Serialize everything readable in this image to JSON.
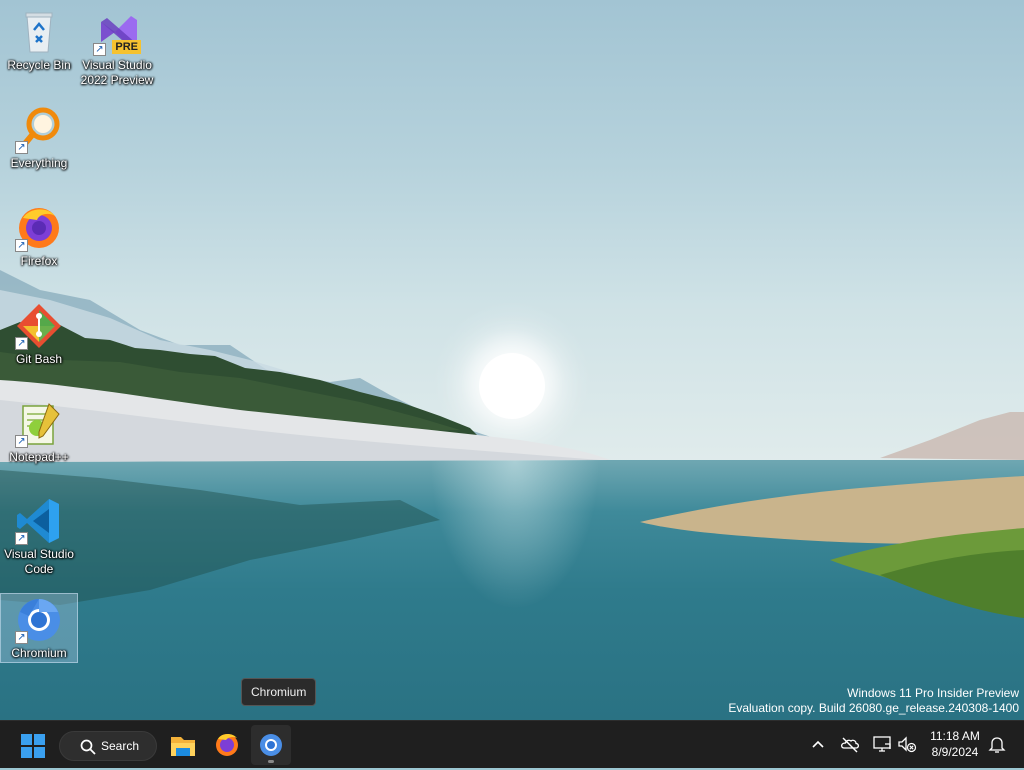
{
  "desktop": {
    "icons": [
      {
        "label": "Recycle Bin"
      },
      {
        "label": "Visual Studio 2022 Preview",
        "line1": "Visual Studio",
        "line2": "2022 Preview",
        "badge": "PRE"
      },
      {
        "label": "Everything"
      },
      {
        "label": "Firefox"
      },
      {
        "label": "Git Bash"
      },
      {
        "label": "Notepad++"
      },
      {
        "label": "Visual Studio Code",
        "line1": "Visual Studio",
        "line2": "Code"
      },
      {
        "label": "Chromium"
      }
    ],
    "tooltip": "Chromium",
    "watermark": {
      "line1": "Windows 11 Pro Insider Preview",
      "line2": "Evaluation copy. Build 26080.ge_release.240308-1400"
    }
  },
  "taskbar": {
    "search_label": "Search",
    "pinned_apps": [
      "file-explorer",
      "firefox",
      "chromium"
    ],
    "active_app": "chromium",
    "tray_icons": [
      "chevron-up-icon",
      "onedrive-offline-icon",
      "network-icon",
      "volume-muted-icon",
      "notification-bell-icon"
    ],
    "clock": {
      "time": "11:18 AM",
      "date": "8/9/2024"
    }
  },
  "colors": {
    "taskbar_bg": "#1f1f1f",
    "start_blue": "#3aa0f0"
  }
}
